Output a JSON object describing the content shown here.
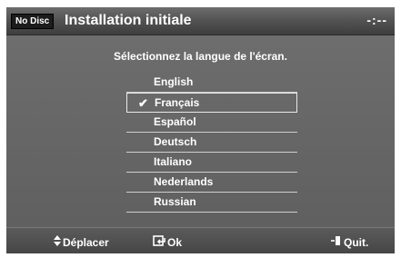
{
  "header": {
    "badge": "No Disc",
    "title": "Installation initiale",
    "clock": "-:--"
  },
  "instruction": "Sélectionnez la langue de l'écran.",
  "languages": [
    {
      "label": "English",
      "selected": false
    },
    {
      "label": "Français",
      "selected": true
    },
    {
      "label": "Español",
      "selected": false
    },
    {
      "label": "Deutsch",
      "selected": false
    },
    {
      "label": "Italiano",
      "selected": false
    },
    {
      "label": "Nederlands",
      "selected": false
    },
    {
      "label": "Russian",
      "selected": false
    }
  ],
  "footer": {
    "move_label": "Déplacer",
    "move_icon": "up-down-arrows-icon",
    "ok_label": "Ok",
    "ok_icon": "enter-key-icon",
    "quit_label": "Quit.",
    "quit_icon": "exit-door-icon"
  },
  "colors": {
    "background": "#666666",
    "titlebar": "#4a4a4a",
    "text": "#ffffff"
  }
}
